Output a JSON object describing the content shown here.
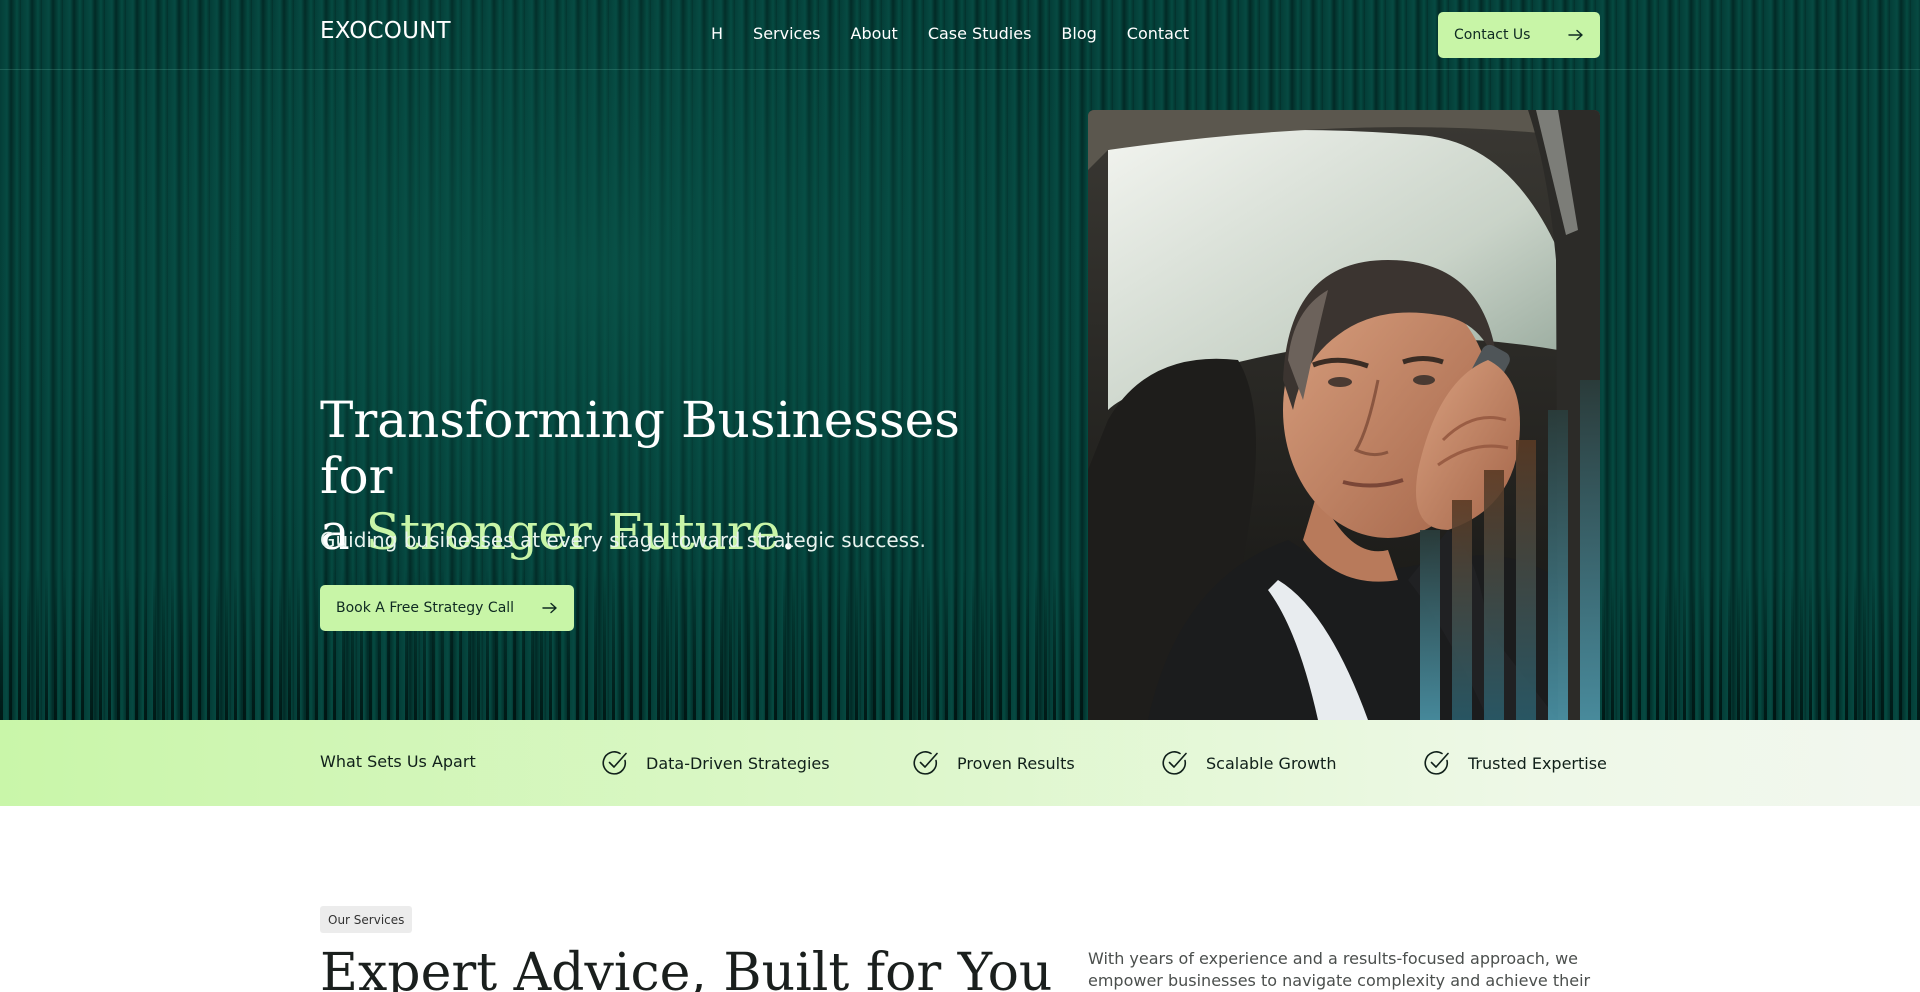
{
  "header": {
    "logo": "EXOCOUNT",
    "nav": [
      "H",
      "Services",
      "About",
      "Case Studies",
      "Blog",
      "Contact"
    ],
    "cta_label": "Contact Us"
  },
  "hero": {
    "title_line1": "Transforming Businesses for",
    "title_line2_prefix": "a ",
    "title_line2_accent": "Stronger Future",
    "title_line2_suffix": ".",
    "subtitle": "Guiding businesses at every stage toward strategic success.",
    "cta_label": "Book A Free Strategy Call",
    "photo_icon": "man-on-phone-in-car-photo"
  },
  "features": {
    "heading": "What Sets Us Apart",
    "items": [
      "Data-Driven Strategies",
      "Proven Results",
      "Scalable Growth",
      "Trusted Expertise"
    ],
    "icon": "check-circle-icon"
  },
  "services": {
    "tag": "Our Services",
    "title": "Expert Advice, Built for You",
    "description": "With years of experience and a results-focused approach, we empower businesses to navigate complexity and achieve their goals."
  },
  "colors": {
    "hero_bg": "#04342f",
    "accent": "#c8f5a7",
    "text_dark": "#10201a"
  }
}
